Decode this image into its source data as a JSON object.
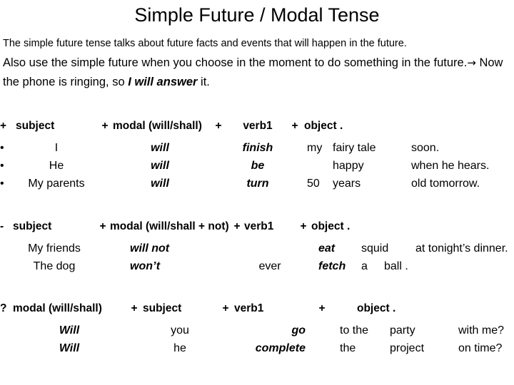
{
  "slide": {
    "title": "Simple Future / Modal Tense",
    "intro": {
      "line1": "The simple future tense talks about future facts and events that will happen in the future.",
      "line2_part1": " Also use the simple future when you choose in the moment to do something in the future.",
      "arrow": "→",
      "line2_part2": "Now the phone is ringing, so",
      "line2_emphasis": "I will answer",
      "line2_part3": "it."
    }
  },
  "affirmative": {
    "sign": "+",
    "bullet": "•",
    "formula": {
      "subject": "subject",
      "plus1": "+",
      "modal": "modal (will/shall)",
      "plus2": "+",
      "verb": "verb1",
      "plus3": "+",
      "object": "object ."
    },
    "rows": [
      {
        "subject": "I",
        "modal": "will",
        "verb": "finish",
        "obj1": "my",
        "obj2": "fairy tale",
        "obj3": "soon."
      },
      {
        "subject": "He",
        "modal": "will",
        "verb": "be",
        "obj1": "",
        "obj2": "happy",
        "obj3": "when he hears."
      },
      {
        "subject": "My parents",
        "modal": "will",
        "verb": "turn",
        "obj1": "50",
        "obj2": "years",
        "obj3": "old tomorrow."
      }
    ]
  },
  "negative": {
    "sign": "-",
    "formula": {
      "subject": "subject",
      "plus1": "+",
      "modal": "modal (will/shall + not)",
      "plus2": "+",
      "verb": "verb1",
      "plus3": "+",
      "object": "object ."
    },
    "rows": [
      {
        "subject": "My friends",
        "modal": "will not",
        "adverb": "",
        "verb": "eat",
        "obj1": "squid",
        "obj2": "at tonight’s dinner."
      },
      {
        "subject": "The dog",
        "modal": "won’t",
        "adverb": "ever",
        "verb": "fetch",
        "obj1": "a",
        "obj2": "ball ."
      }
    ]
  },
  "question": {
    "sign": "?",
    "formula": {
      "modal": "modal (will/shall)",
      "plus1": "+",
      "subject": "subject",
      "plus2": "+",
      "verb": "verb1",
      "plus3": "+",
      "object": "object ."
    },
    "rows": [
      {
        "modal": "Will",
        "subject": "you",
        "verb": "go",
        "obj1": "to the",
        "obj2": "party",
        "obj3": "with me?"
      },
      {
        "modal": "Will",
        "subject": "he",
        "verb": "complete",
        "obj1": "the",
        "obj2": "project",
        "obj3": "on time?"
      }
    ]
  }
}
